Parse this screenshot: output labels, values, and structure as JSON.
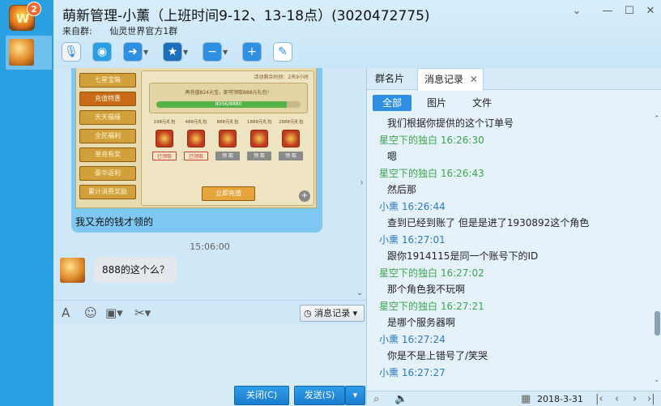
{
  "app": {
    "badge_count": "2",
    "logo_text": "W"
  },
  "header": {
    "title": "萌新管理-小薰（上班时间9-12、13-18点）(3020472775)",
    "from_label": "来自群:",
    "from_group": "仙灵世界官方1群"
  },
  "window_controls": {
    "dropdown": "⌄",
    "minimize": "—",
    "maximize": "☐",
    "close": "✕"
  },
  "toolbar": {
    "items": [
      {
        "name": "voice-call-icon",
        "glyph": "🎙",
        "color": "#f3f3f3"
      },
      {
        "name": "video-call-icon",
        "glyph": "◉",
        "color": "#2aa0e2"
      },
      {
        "name": "file-transfer-icon",
        "glyph": "➜",
        "color": "#2f8fe0"
      },
      {
        "name": "remote-assist-icon",
        "glyph": "★",
        "color": "#1c6fb8"
      },
      {
        "name": "remove-member-icon",
        "glyph": "−",
        "color": "#2f8fe0"
      },
      {
        "name": "add-member-icon",
        "glyph": "+",
        "color": "#2f8fe0"
      },
      {
        "name": "group-notice-icon",
        "glyph": "✎",
        "color": "#ffffff"
      }
    ]
  },
  "game_screenshot": {
    "menu": [
      "七星宝箱",
      "充值特惠",
      "天天福缘",
      "全民福利",
      "单充有奖",
      "豪华返利",
      "累计消费奖励"
    ],
    "active_index": 1,
    "top_note": "活动剩余时间：2天9小时",
    "recharge_msg": "再充值824元宝，即可领取888元礼包！",
    "progress_text": "8056/8880",
    "progress_fraction": 0.907,
    "gifts": [
      {
        "name": "198元礼包",
        "action": "已领取",
        "state": "got"
      },
      {
        "name": "488元礼包",
        "action": "已领取",
        "state": "got"
      },
      {
        "name": "888元礼包",
        "action": "领 取",
        "state": "claim"
      },
      {
        "name": "1888元礼包",
        "action": "领 取",
        "state": "claim"
      },
      {
        "name": "2888元礼包",
        "action": "领 取",
        "state": "claim"
      }
    ],
    "charge_button": "立即充值"
  },
  "chat": {
    "image_caption": "我又充的钱才领的",
    "time": "15:06:00",
    "message": "888的这个么？"
  },
  "input_tools": {
    "history_label": "消息记录"
  },
  "buttons": {
    "close": "关闭(C)",
    "send": "发送(S)"
  },
  "side": {
    "tabs": [
      "群名片",
      "消息记录"
    ],
    "filters": [
      "全部",
      "图片",
      "文件"
    ],
    "colors": {
      "green": "#3ba64a",
      "blue": "#2b78c2"
    },
    "log": [
      {
        "kind": "txt",
        "text": "我们根据你提供的这个订单号"
      },
      {
        "kind": "hdr",
        "color": "green",
        "text": "星空下的独白 16:26:30"
      },
      {
        "kind": "txt",
        "text": "嗯"
      },
      {
        "kind": "hdr",
        "color": "green",
        "text": "星空下的独白 16:26:43"
      },
      {
        "kind": "txt",
        "text": "然后那"
      },
      {
        "kind": "hdr",
        "color": "blue",
        "text": "小熏 16:26:44"
      },
      {
        "kind": "txt",
        "text": "查到已经到账了 但是是进了1930892这个角色"
      },
      {
        "kind": "hdr",
        "color": "blue",
        "text": "小熏 16:27:01"
      },
      {
        "kind": "txt",
        "text": "跟你1914115是同一个账号下的ID"
      },
      {
        "kind": "hdr",
        "color": "green",
        "text": "星空下的独白 16:27:02"
      },
      {
        "kind": "txt",
        "text": "那个角色我不玩啊"
      },
      {
        "kind": "hdr",
        "color": "green",
        "text": "星空下的独白 16:27:21"
      },
      {
        "kind": "txt",
        "text": "是哪个服务器啊"
      },
      {
        "kind": "hdr",
        "color": "blue",
        "text": "小熏 16:27:24"
      },
      {
        "kind": "txt",
        "text": "你是不是上错号了/笑哭"
      },
      {
        "kind": "hdr",
        "color": "blue",
        "text": "小熏 16:27:27"
      }
    ],
    "date": "2018-3-31"
  }
}
